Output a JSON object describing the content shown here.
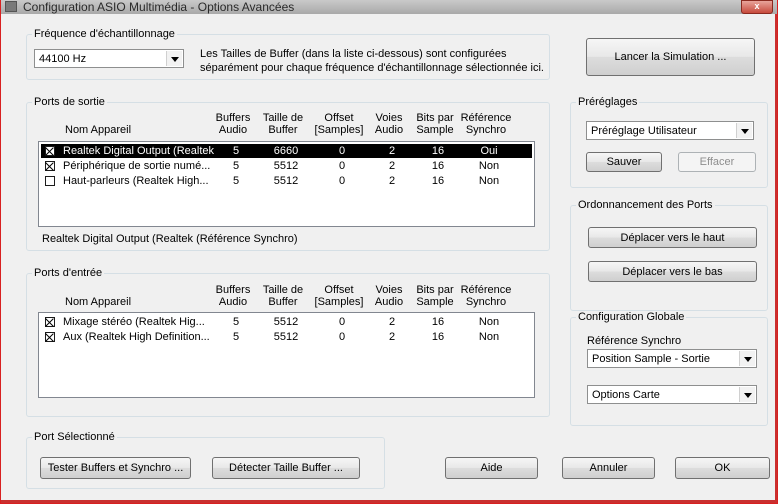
{
  "window": {
    "title": "Configuration ASIO Multimédia  - Options Avancées",
    "close_label": "x"
  },
  "frequency": {
    "label": "Fréquence d'échantillonnage",
    "value": "44100 Hz",
    "description_line1": "Les Tailles de Buffer (dans la liste ci-dessous) sont configurées",
    "description_line2": "séparément pour chaque fréquence d'échantillonnage sélectionnée ici."
  },
  "columns": {
    "name": "Nom Appareil",
    "buffers_1": "Buffers",
    "buffers_2": "Audio",
    "size_1": "Taille de",
    "size_2": "Buffer",
    "offset_1": "Offset",
    "offset_2": "[Samples]",
    "voices_1": "Voies",
    "voices_2": "Audio",
    "bits_1": "Bits par",
    "bits_2": "Sample",
    "ref_1": "Référence",
    "ref_2": "Synchro"
  },
  "output_ports": {
    "label": "Ports de sortie",
    "rows": [
      {
        "name": "Realtek Digital Output (Realtek",
        "buffers": "5",
        "size": "6660",
        "offset": "0",
        "voices": "2",
        "bits": "16",
        "ref": "Oui",
        "checked": true,
        "selected": true
      },
      {
        "name": "Périphérique de sortie numé...",
        "buffers": "5",
        "size": "5512",
        "offset": "0",
        "voices": "2",
        "bits": "16",
        "ref": "Non",
        "checked": true,
        "selected": false
      },
      {
        "name": "Haut-parleurs (Realtek High...",
        "buffers": "5",
        "size": "5512",
        "offset": "0",
        "voices": "2",
        "bits": "16",
        "ref": "Non",
        "checked": false,
        "selected": false
      }
    ],
    "status": "Realtek Digital Output (Realtek (Référence Synchro)"
  },
  "input_ports": {
    "label": "Ports d'entrée",
    "rows": [
      {
        "name": "Mixage stéréo (Realtek Hig...",
        "buffers": "5",
        "size": "5512",
        "offset": "0",
        "voices": "2",
        "bits": "16",
        "ref": "Non",
        "checked": true,
        "selected": false
      },
      {
        "name": "Aux (Realtek High Definition...",
        "buffers": "5",
        "size": "5512",
        "offset": "0",
        "voices": "2",
        "bits": "16",
        "ref": "Non",
        "checked": true,
        "selected": false
      }
    ]
  },
  "selected_port": {
    "label": "Port Sélectionné",
    "test_button": "Tester Buffers et Synchro ...",
    "detect_button": "Détecter Taille Buffer ..."
  },
  "simulation_button": "Lancer la Simulation ...",
  "presets": {
    "label": "Préréglages",
    "value": "Préréglage Utilisateur",
    "save": "Sauver",
    "delete": "Effacer"
  },
  "port_order": {
    "label": "Ordonnancement des Ports",
    "up": "Déplacer vers le haut",
    "down": "Déplacer vers le bas"
  },
  "global_config": {
    "label": "Configuration Globale",
    "sync_label": "Référence Synchro",
    "sync_value": "Position Sample - Sortie",
    "card_value": "Options Carte"
  },
  "footer": {
    "help": "Aide",
    "cancel": "Annuler",
    "ok": "OK"
  }
}
